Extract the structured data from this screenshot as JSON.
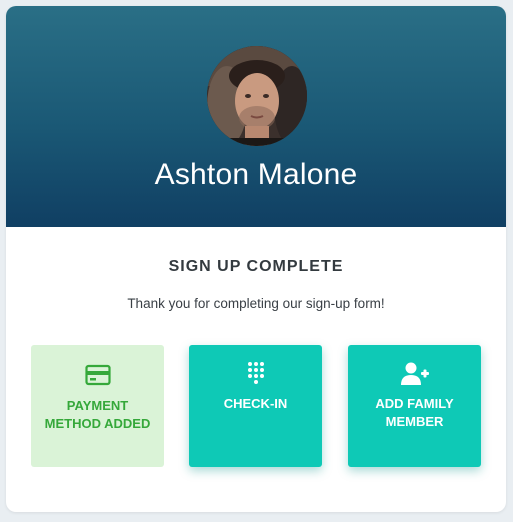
{
  "profile": {
    "name": "Ashton Malone"
  },
  "status": {
    "title": "SIGN UP COMPLETE",
    "message": "Thank you for completing our sign-up form!"
  },
  "actions": [
    {
      "label": "PAYMENT METHOD ADDED",
      "icon": "credit-card-icon",
      "state": "completed"
    },
    {
      "label": "CHECK-IN",
      "icon": "keypad-icon",
      "state": "available"
    },
    {
      "label": "ADD FAMILY MEMBER",
      "icon": "add-user-icon",
      "state": "available"
    }
  ],
  "colors": {
    "header_top": "#2a6f86",
    "header_bottom": "#103f63",
    "teal": "#0ec9b6",
    "success_bg": "#daf3d7",
    "success_text": "#35a83a"
  }
}
